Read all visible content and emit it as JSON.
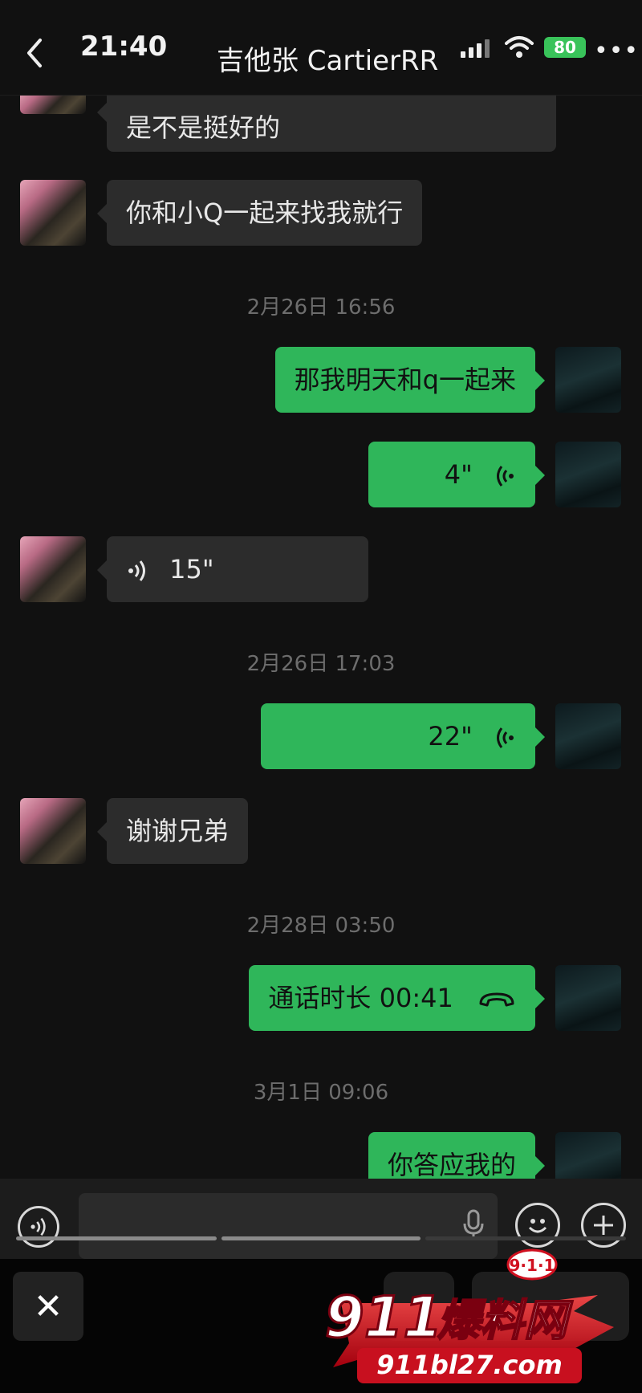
{
  "status": {
    "time": "21:40",
    "battery": "80"
  },
  "header": {
    "title": "吉他张 CartierRR"
  },
  "messages": {
    "m0": "是不是挺好的",
    "m1": "你和小Q一起来找我就行",
    "ts1": "2月26日 16:56",
    "m2": "那我明天和q一起来",
    "m3_dur": "4\"",
    "m4_dur": "15\"",
    "ts2": "2月26日 17:03",
    "m5_dur": "22\"",
    "m6": "谢谢兄弟",
    "ts3": "2月28日 03:50",
    "m7": "通话时长 00:41",
    "ts4": "3月1日 09:06",
    "m8": "你答应我的"
  },
  "watermark": {
    "badge": "9·1·1",
    "brand": "911爆料网",
    "url": "911bl27.com"
  },
  "colors": {
    "sent": "#2fb65a",
    "received": "#2c2c2c",
    "background": "#111111",
    "brand_red": "#e0192b"
  },
  "icons": [
    "back-icon",
    "signal-icon",
    "wifi-icon",
    "battery-icon",
    "more-icon",
    "voice-wave-icon",
    "phone-icon",
    "voice-input-icon",
    "mic-icon",
    "emoji-icon",
    "plus-icon",
    "close-icon"
  ]
}
